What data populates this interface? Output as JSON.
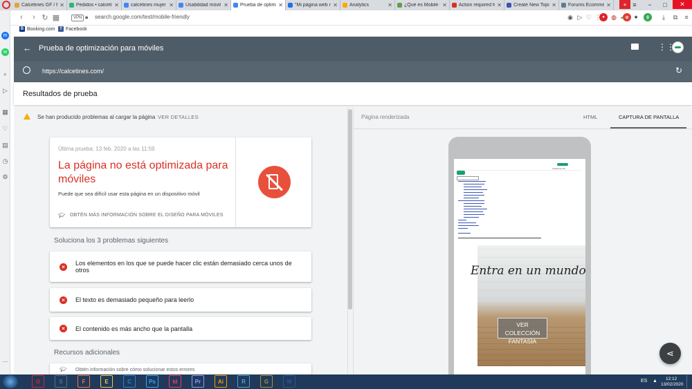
{
  "browser": {
    "tabs": [
      {
        "label": "Calcetines GF / Fu",
        "color": "#e1a53a"
      },
      {
        "label": "Pedidos • calcetín",
        "color": "#2bb673"
      },
      {
        "label": "calcetines mujer -",
        "color": "#4285f4"
      },
      {
        "label": "Usabilidad móvil",
        "color": "#4285f4"
      },
      {
        "label": "Prueba de optimiz",
        "color": "#4285f4"
      },
      {
        "label": "\"Mi página web no",
        "color": "#1a73e8"
      },
      {
        "label": "Analytics",
        "color": "#f9ab00"
      },
      {
        "label": "¿Qué es Mobile Fi",
        "color": "#5f9f4b"
      },
      {
        "label": "Action required fo",
        "color": "#d93025"
      },
      {
        "label": "Create New Topic",
        "color": "#3f51b5"
      },
      {
        "label": "Forums Ecommer",
        "color": "#607d8b"
      }
    ],
    "active_tab_index": 4,
    "new_tab_label": "+",
    "url": "search.google.com/test/mobile-friendly",
    "vpn_label": "VPN",
    "bookmarks": [
      {
        "label": "Booking.com",
        "icon": "B",
        "color": "#003580"
      },
      {
        "label": "Facebook",
        "icon": "f",
        "color": "#3b5998"
      }
    ],
    "sidebar_more": "..."
  },
  "app": {
    "title": "Prueba de optimización para móviles",
    "tested_url": "https://calcetines.com/",
    "results_title": "Resultados de prueba"
  },
  "left": {
    "warning_text": "Se han producido problemas al cargar la página",
    "warning_link": "VER DETALLES",
    "last_test": "Última prueba: 13 feb. 2020 a las 11:59",
    "verdict": "La página no está optimizada para móviles",
    "verdict_sub": "Puede que sea difícil usar esta página en un dispositivo móvil",
    "more_info": "OBTÉN MÁS INFORMACIÓN SOBRE EL DISEÑO PARA MÓVILES",
    "fix_title": "Soluciona los 3 problemas siguientes",
    "issues": [
      "Los elementos en los que se puede hacer clic están demasiado cerca unos de otros",
      "El texto es demasiado pequeño para leerlo",
      "El contenido es más ancho que la pantalla"
    ],
    "resources_title": "Recursos adicionales",
    "resource_item": "Obtén información sobre cómo solucionar estos errores"
  },
  "right": {
    "panel_title": "Página renderizada",
    "tab_html": "HTML",
    "tab_screenshot": "CAPTURA DE PANTALLA",
    "site_banner_text": "Entra en un mundo de F",
    "site_button": "VER COLECCIÓN FANTASÍA",
    "site_logo_text": "Calcetines GF"
  },
  "taskbar": {
    "lang": "ES",
    "time": "12:12",
    "date": "13/02/2020",
    "apps": [
      {
        "label": "O",
        "color": "#e0242b"
      },
      {
        "label": "S",
        "color": "#5b6f85"
      },
      {
        "label": "F",
        "color": "#ff7139"
      },
      {
        "label": "E",
        "color": "#f2c94c"
      },
      {
        "label": "C",
        "color": "#1e88e5"
      },
      {
        "label": "Ps",
        "color": "#31a8ff"
      },
      {
        "label": "Id",
        "color": "#ff3366"
      },
      {
        "label": "Pr",
        "color": "#9999ff"
      },
      {
        "label": "Ai",
        "color": "#ff9a00"
      },
      {
        "label": "R",
        "color": "#4fa3d9"
      },
      {
        "label": "G",
        "color": "#b08d3e"
      },
      {
        "label": "W",
        "color": "#2b579a"
      }
    ]
  }
}
